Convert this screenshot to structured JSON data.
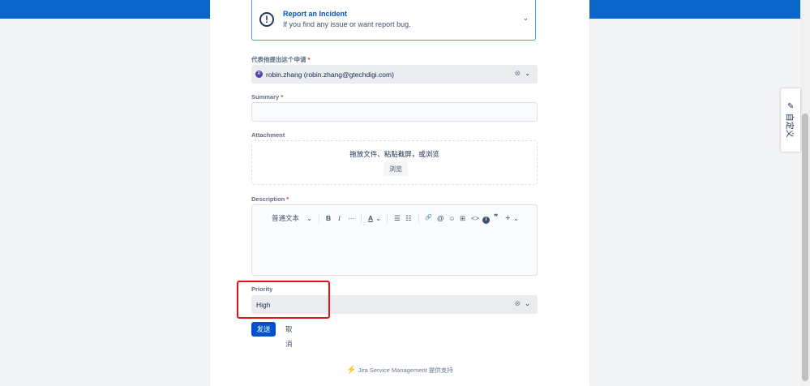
{
  "request_type": {
    "title": "Report an Incident",
    "description": "If you find any issue or want report bug.",
    "icon": "alert-circle-icon"
  },
  "raise_on_behalf": {
    "label": "代表他提出这个申请",
    "required_mark": "*",
    "avatar_initial": "R",
    "value": "robin.zhang (robin.zhang@gtechdigi.com)"
  },
  "summary": {
    "label": "Summary",
    "required_mark": "*",
    "value": ""
  },
  "attachment": {
    "label": "Attachment",
    "drop_text": "拖放文件、粘贴截屏，或浏览",
    "browse_label": "浏览"
  },
  "description": {
    "label": "Description",
    "required_mark": "*",
    "toolbar": {
      "text_style": "普通文本",
      "bold": "B",
      "italic": "I",
      "more": "···",
      "text_color": "A",
      "bullet_list": "☰",
      "number_list": "☷",
      "link": "🔗",
      "mention": "@",
      "emoji": "☺",
      "table": "⊞",
      "code": "<>",
      "info": "i",
      "quote": "❞",
      "insert": "+"
    }
  },
  "priority": {
    "label": "Priority",
    "value": "High"
  },
  "actions": {
    "submit_label": "发送",
    "cancel_label": "取消"
  },
  "footer": {
    "text": "Jira Service Management 提供支持"
  },
  "side_tab": {
    "label": "自定义"
  },
  "colors": {
    "header": "#0a66c8",
    "primary": "#0052cc",
    "highlight": "#e0141b"
  }
}
